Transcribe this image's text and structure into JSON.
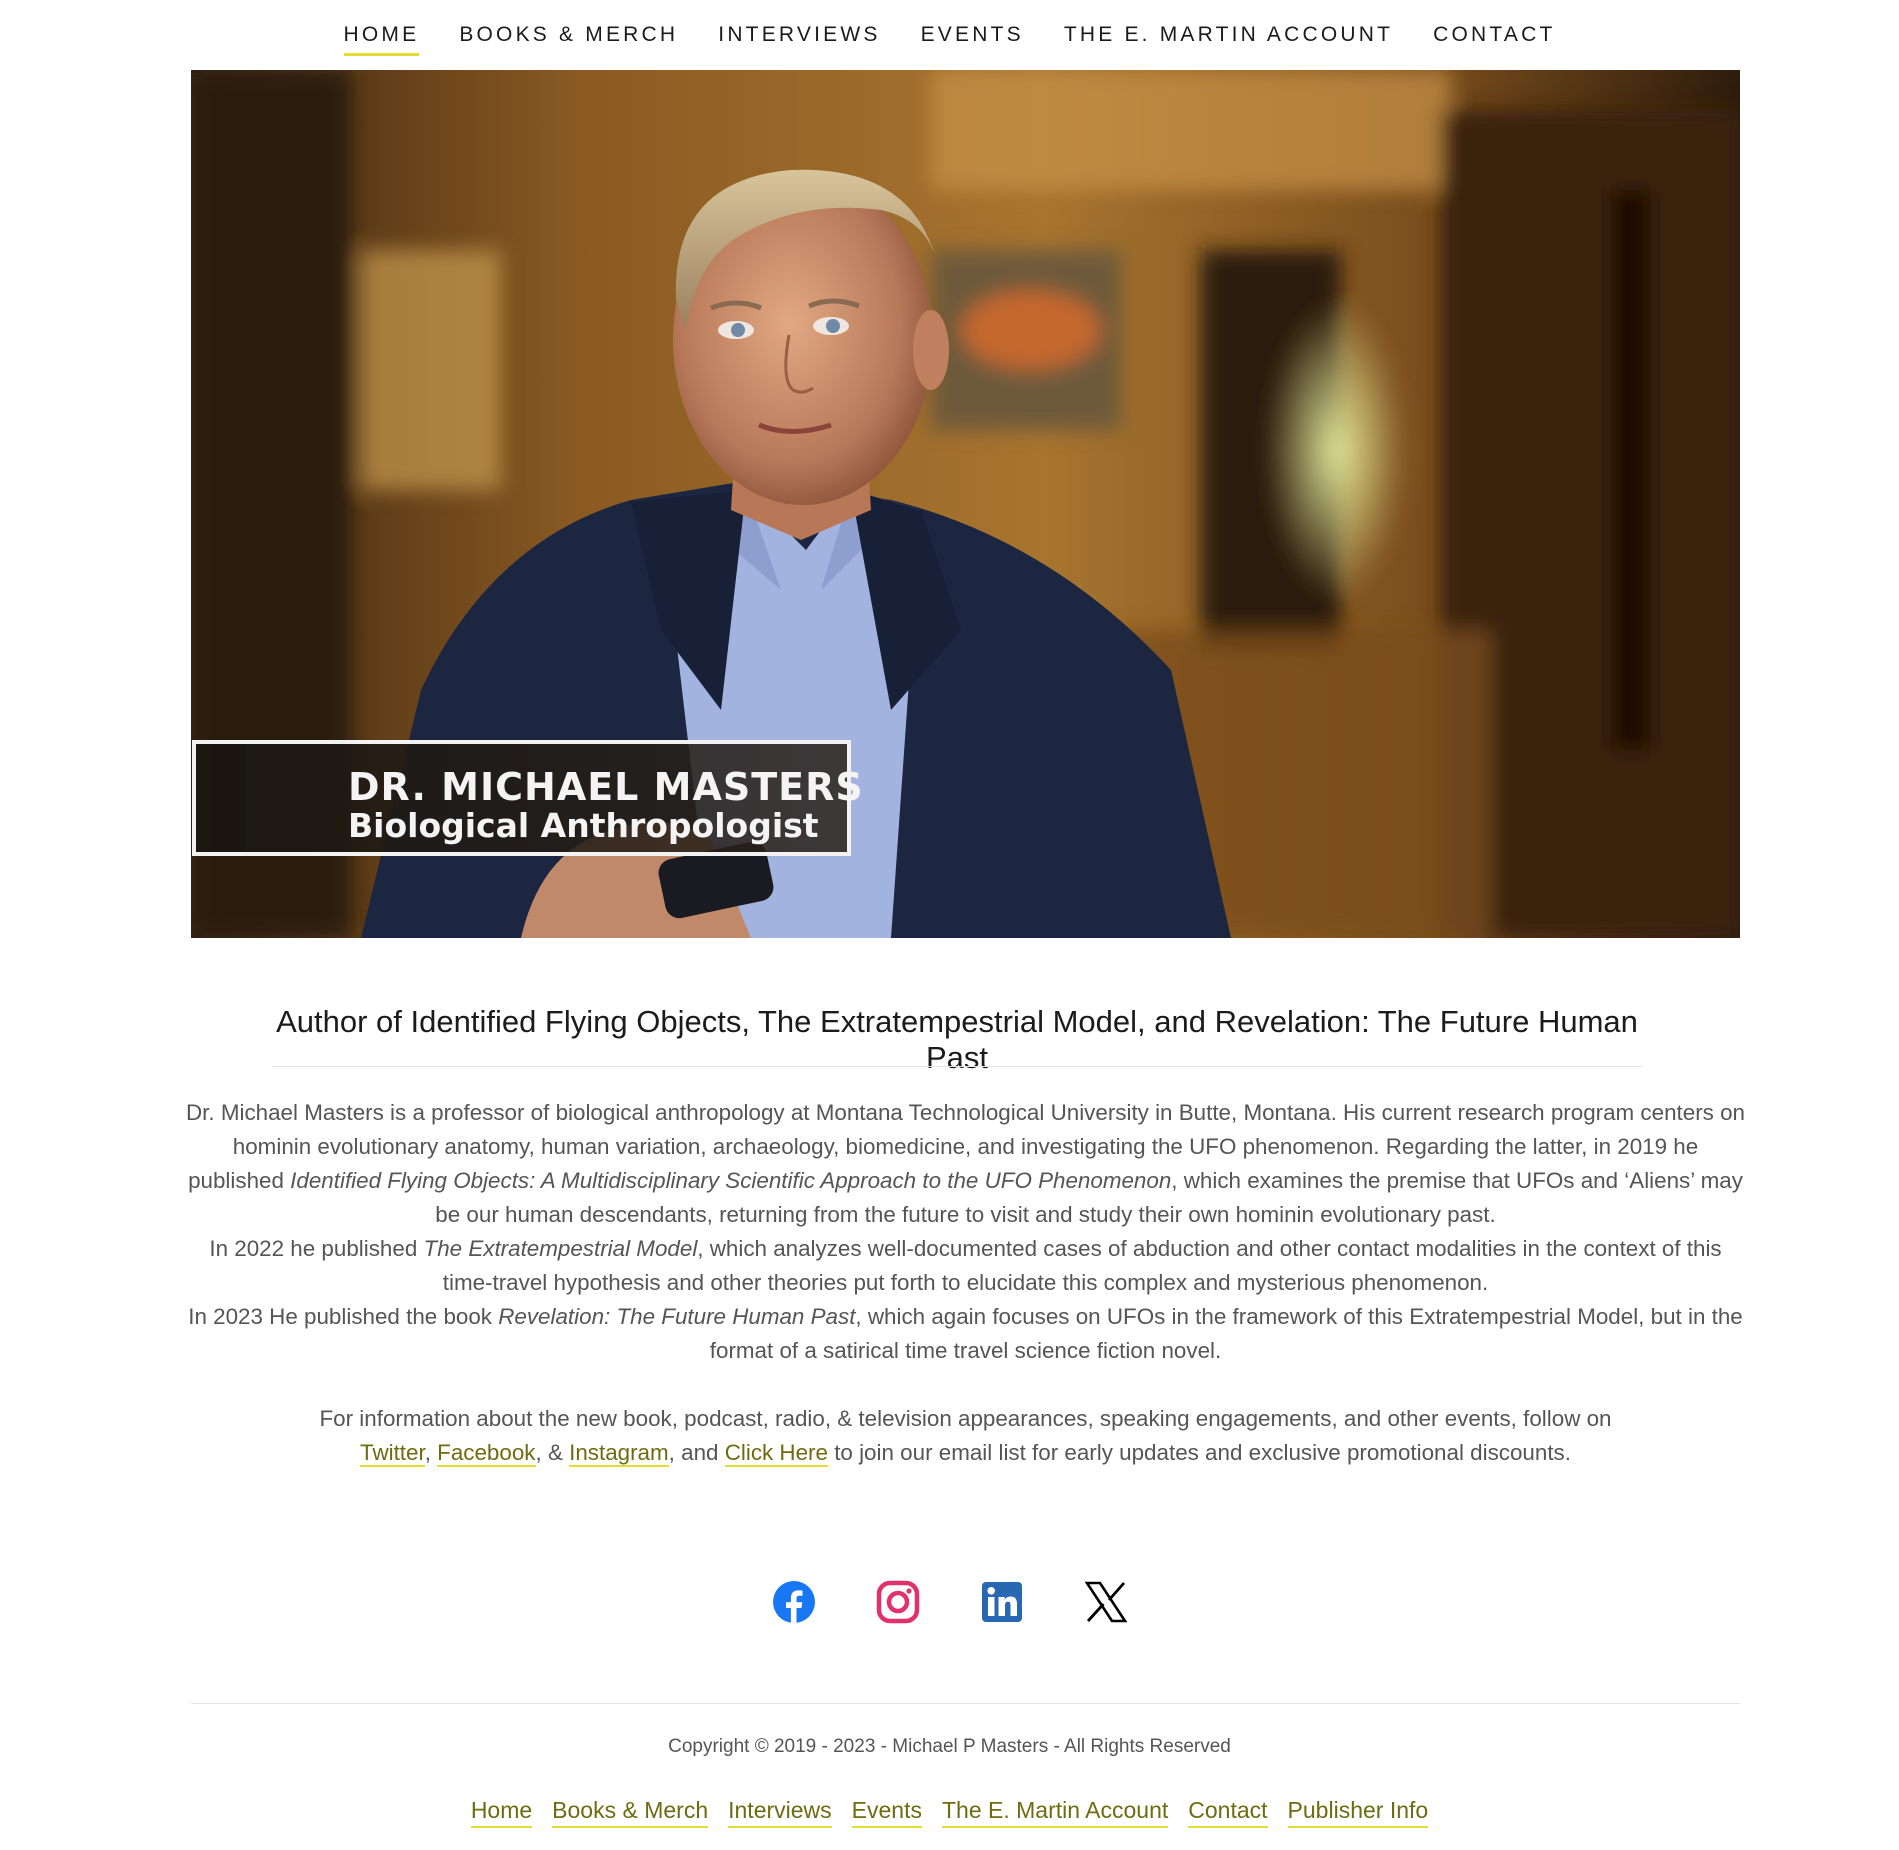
{
  "nav": {
    "items": [
      {
        "label": "HOME",
        "active": true
      },
      {
        "label": "BOOKS & MERCH",
        "active": false
      },
      {
        "label": "INTERVIEWS",
        "active": false
      },
      {
        "label": "EVENTS",
        "active": false
      },
      {
        "label": "THE E. MARTIN ACCOUNT",
        "active": false
      },
      {
        "label": "CONTACT",
        "active": false
      }
    ]
  },
  "hero": {
    "lower_third_name": "DR. MICHAEL MASTERS",
    "lower_third_title": "Biological Anthropologist"
  },
  "headline": "Author of Identified Flying Objects, The Extratempestrial Model, and Revelation: The Future Human Past",
  "bio": {
    "p1_a": "Dr. Michael Masters is a professor of biological anthropology at Montana Technological University in Butte, Montana. His current research program centers on hominin evolutionary anatomy, human variation, archaeology, biomedicine, and investigating the UFO phenomenon. Regarding the latter, in 2019 he published ",
    "p1_em": "Identified Flying Objects: A Multidisciplinary Scientific Approach to the UFO Phenomenon",
    "p1_b": ", which examines the premise that UFOs and ‘Aliens’ may be our human descendants, returning from the future to visit and study their own hominin evolutionary past.",
    "p2_a": "In 2022 he published ",
    "p2_em": "The Extratempestrial Model",
    "p2_b": ", which analyzes well-documented cases of abduction and other contact modalities in the context of this time-travel hypothesis and other theories put forth to elucidate this complex and mysterious phenomenon.",
    "p3_a": "In 2023 He published the book ",
    "p3_em": "Revelation: The Future Human Past",
    "p3_b": ", which again focuses on UFOs in the framework of this Extratempestrial Model, but in the format of a satirical time travel science fiction novel.",
    "p4_a": "For information about the new book, podcast, radio, & television appearances, speaking engagements, and other events, follow on ",
    "link_twitter": "Twitter",
    "sep1": ", ",
    "link_facebook": "Facebook",
    "sep2": ", & ",
    "link_instagram": "Instagram",
    "sep3": ", and ",
    "link_click_here": "Click Here",
    "p4_b": " to join our email list for early updates and exclusive promotional discounts."
  },
  "social": {
    "icons": [
      "facebook-icon",
      "instagram-icon",
      "linkedin-icon",
      "x-icon"
    ],
    "colors": {
      "facebook": "#1877F2",
      "instagram": "#E1306C",
      "linkedin": "#2867B2",
      "x": "#000000"
    }
  },
  "footer": {
    "copyright": "Copyright © 2019 - 2023 - Michael P Masters - All Rights Reserved",
    "links": [
      "Home",
      "Books & Merch",
      "Interviews",
      "Events",
      "The E. Martin Account",
      "Contact",
      "Publisher Info"
    ]
  },
  "colors": {
    "accent_underline": "#e3dd33",
    "link_text": "#6e6c10",
    "body_text": "#555555"
  }
}
